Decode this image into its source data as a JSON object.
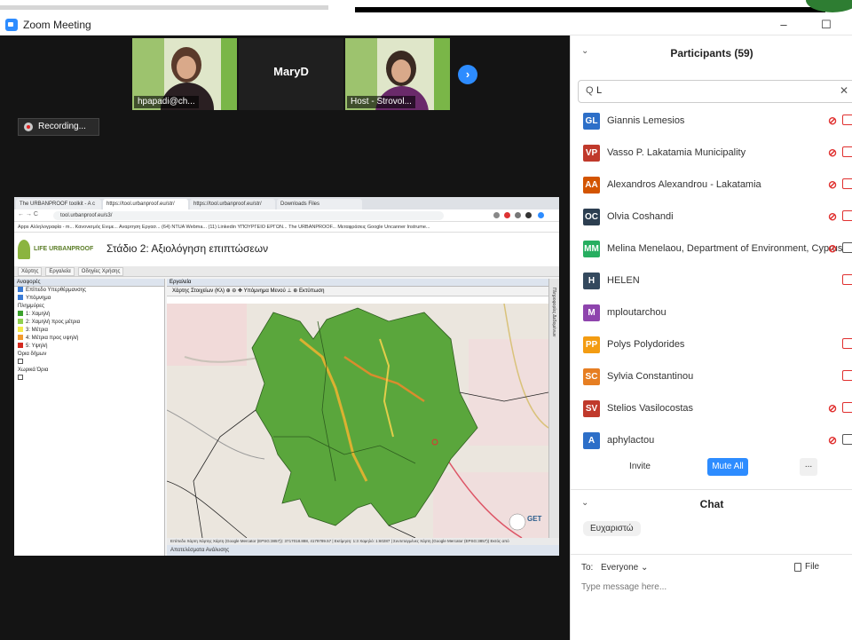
{
  "window": {
    "title": "Zoom Meeting",
    "controls": [
      "–",
      "☐"
    ]
  },
  "gallery": {
    "thumbs": [
      {
        "name": "hpapadi@ch..."
      },
      {
        "name": "MaryD"
      },
      {
        "name": "Host - Strovol..."
      }
    ]
  },
  "recording": {
    "label": "Recording..."
  },
  "shared_screen": {
    "tabs": [
      "The URBANPROOF toolkit - A c",
      "https://tool.urbanproof.eu/str/",
      "https://tool.urbanproof.eu/str/",
      "Downloads Files"
    ],
    "url": "tool.urbanproof.eu/s3/",
    "bookmarks": "Apps   Αλληλογραφία - m...   Κανονισμός Ενιμε...   Αναρτηση Εργασ...   (64) NTUA Webma...   (11) Linkedin   ΥΠΟΥΡΓΕΙΟ ΕΡΓΩΝ...   The URBANPROOF...   Μεταφράσεις Google   Uncanner Instrume...",
    "logo_text": "LIFE URBANPROOF",
    "stage_title": "Στάδιο 2: Αξιολόγηση επιπτώσεων",
    "app_tabs": [
      "Χάρτης",
      "Εργαλεία",
      "Οδηγίες Χρήσης"
    ],
    "left_pane": {
      "header": "Αναφορές",
      "layer1": "Επίπεδο Υπερθέρμανσης",
      "layer2": "Υπόμνημα",
      "legend_title": "Πλημμύρες",
      "legend": [
        {
          "label": "1: Χαμηλή",
          "color": "#3aa12b"
        },
        {
          "label": "2: Χαμηλή προς μέτρια",
          "color": "#8fd14f"
        },
        {
          "label": "3: Μέτρια",
          "color": "#f3ea4a"
        },
        {
          "label": "4: Μέτρια προς υψηλή",
          "color": "#f29a2e"
        },
        {
          "label": "5: Υψηλή",
          "color": "#d42a20"
        }
      ],
      "extra1": "Όρια δήμων",
      "extra2": "Χωρικά Όρια"
    },
    "map_pane": {
      "header": "Εργαλεία",
      "toolbar": "Χάρτης Στοιχείων (Κλ)  ⊕ ⊖ ✥  Υπόμνημα   Μενού   ⊥  ⊕  Εκτύπωση",
      "status": "Επίπεδο Χάρτη    Χάρτης Χάρτη (Google Mercator (EPSG:3857)): 3717018.888, 4179789.57 | Εκτίμηση: 1:3 Χαμηλό: 1:60287 | Συντεταγμένες Χάρτη (Google Mercator (EPSG:3857)) Εκτός από",
      "footer": "Αποτελέσματα Ανάλυσης",
      "side": "Πληροφορίες Δεδομένων",
      "watermark": "GET"
    }
  },
  "participants_panel": {
    "title": "Participants (59)",
    "search_value": "L",
    "search_icon_text": "Q",
    "participants": [
      {
        "initials": "GL",
        "name": "Giannis Lemesios",
        "color": "#2d6fc8",
        "mic_off": true,
        "video_off": true
      },
      {
        "initials": "VP",
        "name": "Vasso P. Lakatamia Municipality",
        "color": "#c0392b",
        "mic_off": true,
        "video_off": true
      },
      {
        "initials": "AA",
        "name": "Alexandros Alexandrou - Lakatamia",
        "color": "#d35400",
        "mic_off": true,
        "video_off": true
      },
      {
        "initials": "OC",
        "name": "Olvia Coshandi",
        "color": "#2c3e50",
        "mic_off": true,
        "video_off": true
      },
      {
        "initials": "MM",
        "name": "Melina Menelaou, Department of Environment, Cyprus",
        "color": "#27ae60",
        "mic_off": true,
        "video_off": false
      },
      {
        "initials": "H",
        "name": "HELEN",
        "color": "#34495e",
        "mic_off": false,
        "video_off": true
      },
      {
        "initials": "M",
        "name": "mploutarchou",
        "color": "#8e44ad",
        "mic_off": false,
        "video_off": false
      },
      {
        "initials": "PP",
        "name": "Polys Polydorides",
        "color": "#f39c12",
        "mic_off": false,
        "video_off": true
      },
      {
        "initials": "SC",
        "name": "Sylvia Constantinou",
        "color": "#e67e22",
        "mic_off": false,
        "video_off": true
      },
      {
        "initials": "SV",
        "name": "Stelios Vasilocostas",
        "color": "#c0392b",
        "mic_off": true,
        "video_off": true
      },
      {
        "initials": "A",
        "name": "aphylactou",
        "color": "#2d6fc8",
        "mic_off": true,
        "video_off": false
      }
    ],
    "invite_label": "Invite",
    "mute_all_label": "Mute All",
    "more_label": "..."
  },
  "chat": {
    "title": "Chat",
    "message": "Ευχαριστώ",
    "to_label": "To:",
    "recipient": "Everyone ⌄",
    "file_label": "File",
    "input_placeholder": "Type message here..."
  }
}
